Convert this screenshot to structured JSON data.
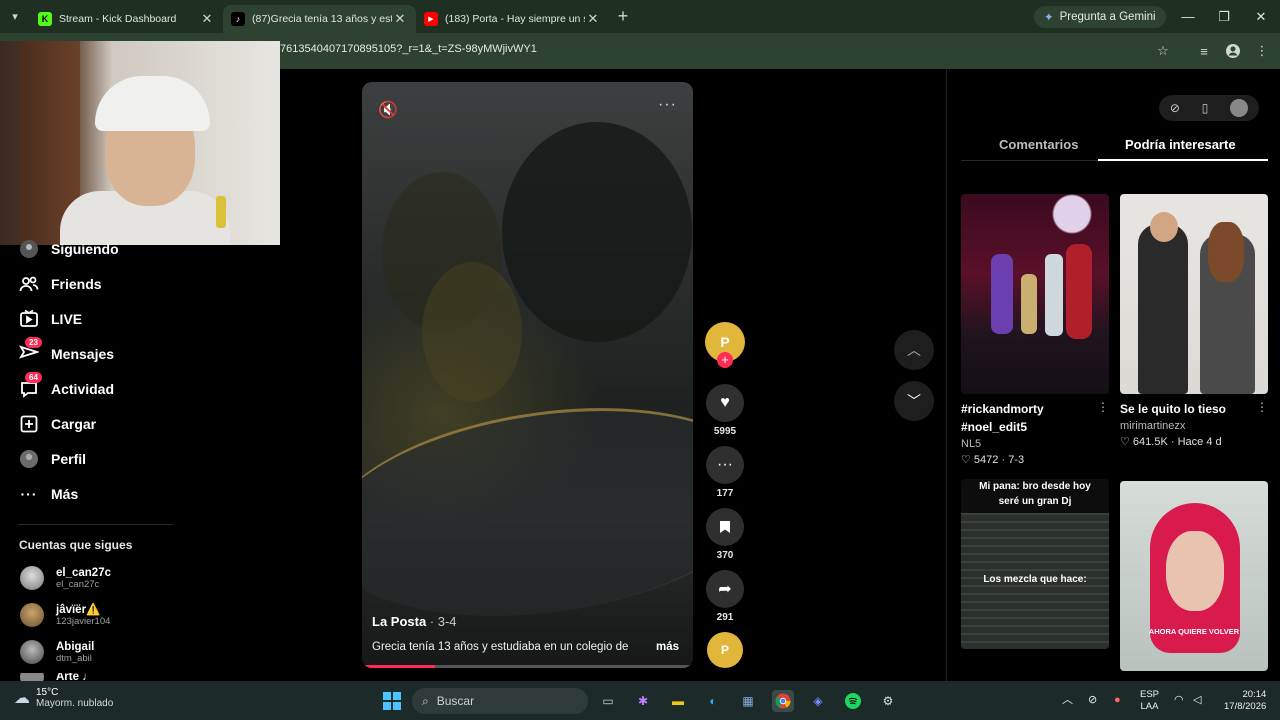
{
  "browser": {
    "tabs": [
      {
        "title": "Stream - Kick Dashboard",
        "favicon": "K",
        "favicon_color": "#53fc18"
      },
      {
        "title": "(87)Grecia tenía 13 años y estu",
        "favicon": "♪",
        "favicon_color": "#000000"
      },
      {
        "title": "(183) Porta - Hay siempre un se",
        "favicon": "▶",
        "favicon_color": "#ff0000"
      }
    ],
    "gemini_label": "Pregunta a Gemini",
    "url": "7613540407170895105?_r=1&_t=ZS-98yMWjivWY1"
  },
  "sidebar": {
    "items": [
      {
        "label": "Siguiendo",
        "icon": "following-icon"
      },
      {
        "label": "Friends",
        "icon": "friends-icon"
      },
      {
        "label": "LIVE",
        "icon": "live-icon"
      },
      {
        "label": "Mensajes",
        "icon": "messages-icon",
        "badge": "23"
      },
      {
        "label": "Actividad",
        "icon": "activity-icon",
        "badge": "64"
      },
      {
        "label": "Cargar",
        "icon": "upload-icon"
      },
      {
        "label": "Perfil",
        "icon": "profile-icon"
      },
      {
        "label": "Más",
        "icon": "more-icon"
      }
    ],
    "following_header": "Cuentas que sigues",
    "accounts": [
      {
        "name": "el_can27c",
        "handle": "el_can27c"
      },
      {
        "name": "jâvïër⚠️",
        "handle": "123javier104"
      },
      {
        "name": "Abigail",
        "handle": "dtm_abil"
      },
      {
        "name": "Arte ♩",
        "handle": ""
      }
    ]
  },
  "video": {
    "author": "La Posta",
    "date": " · 3-4",
    "description": "Grecia tenía 13 años y estudiaba en un colegio de",
    "more_label": "más",
    "progress": 0.22
  },
  "actions": {
    "likes": "5995",
    "comments": "177",
    "saves": "370",
    "shares": "291"
  },
  "right_panel": {
    "tab_comments": "Comentarios",
    "tab_suggested": "Podría interesarte",
    "cards": [
      {
        "title": "#rickandmorty #noel_edit5",
        "author": "NL5",
        "likes": "5472",
        "date": "7-3"
      },
      {
        "title": "Se le quito lo tieso",
        "author": "mirimartinezx",
        "likes": "641.5K",
        "date": "Hace 4 d"
      },
      {
        "overlay_top": "Mi pana: bro desde hoy seré un gran Dj",
        "overlay_mid": "Los mezcla que hace:"
      },
      {
        "overlay_bottom": "AHORA QUIERE VOLVER"
      }
    ]
  },
  "taskbar": {
    "temp": "15°C",
    "weather": "Mayorm. nublado",
    "search_placeholder": "Buscar",
    "lang": "ESP",
    "lang2": "LAA",
    "time": "20:14",
    "date": "17/8/2026"
  }
}
